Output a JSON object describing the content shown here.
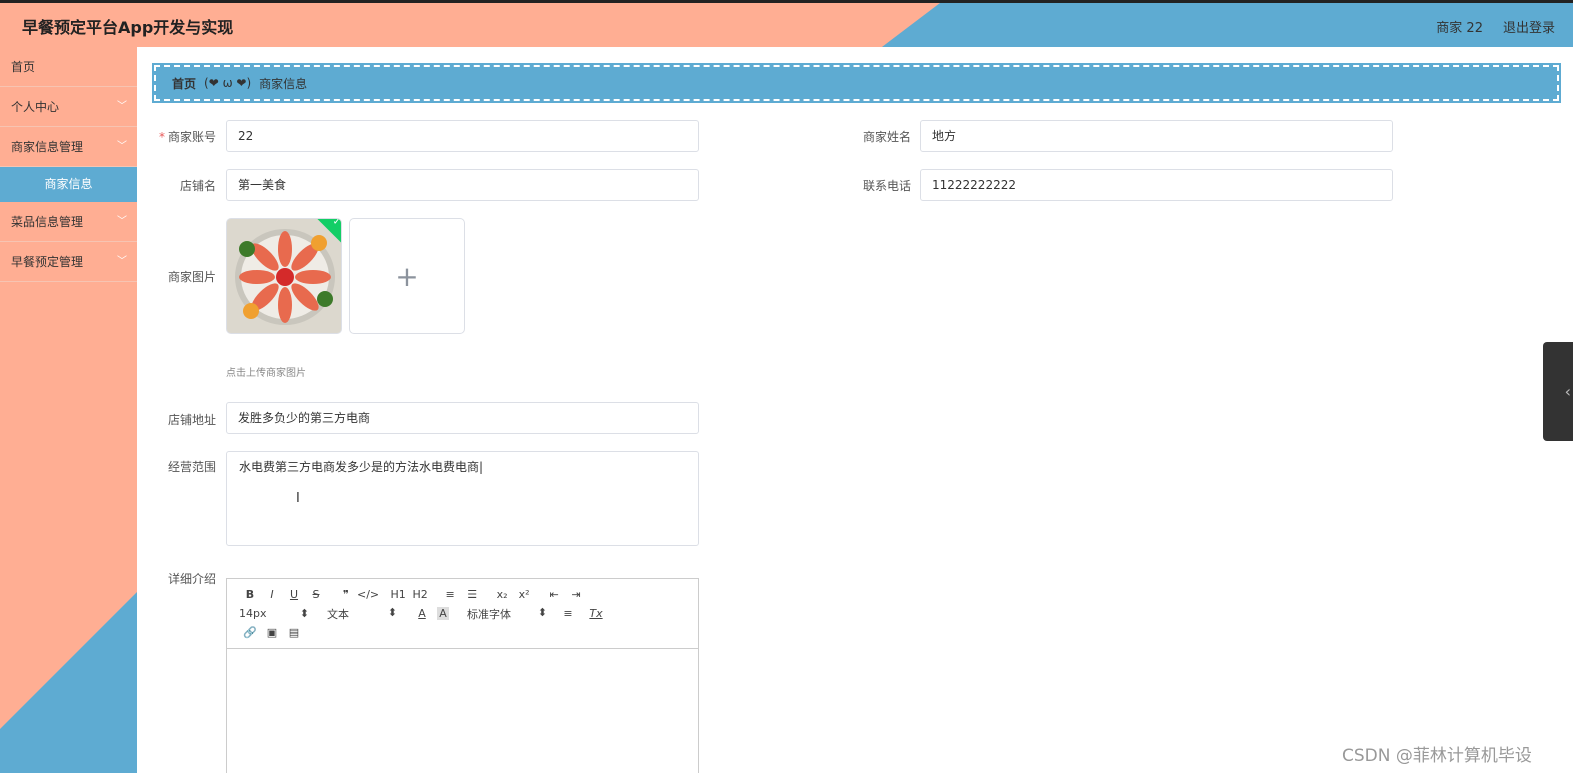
{
  "header": {
    "title": "早餐预定平台App开发与实现",
    "user": "商家 22",
    "logout": "退出登录"
  },
  "sidebar": {
    "items": [
      {
        "label": "首页"
      },
      {
        "label": "个人中心"
      },
      {
        "label": "商家信息管理"
      },
      {
        "label": "商家信息",
        "sub": true
      },
      {
        "label": "菜品信息管理"
      },
      {
        "label": "早餐预定管理"
      }
    ]
  },
  "breadcrumb": {
    "home": "首页",
    "face": "(❤ ω ❤)",
    "current": "商家信息"
  },
  "form": {
    "account_label": "商家账号",
    "account_value": "22",
    "name_label": "商家姓名",
    "name_value": "地方",
    "shop_label": "店铺名",
    "shop_value": "第一美食",
    "phone_label": "联系电话",
    "phone_value": "11222222222",
    "image_label": "商家图片",
    "image_hint": "点击上传商家图片",
    "address_label": "店铺地址",
    "address_value": "发胜多负少的第三方电商",
    "scope_label": "经营范围",
    "scope_value": "水电费第三方电商发多少是的方法水电费电商|",
    "detail_label": "详细介绍"
  },
  "editor": {
    "row1": [
      "B",
      "I",
      "U",
      "S",
      "❞",
      "</>",
      "H1",
      "H2",
      "≡",
      "☰",
      "x₂",
      "x²",
      "⇤",
      "⇥"
    ],
    "font_size": "14px",
    "text_style": "文本",
    "font_family": "标准字体",
    "clear_format": "Tx"
  },
  "watermark": "CSDN @菲林计算机毕设",
  "colors": {
    "salmon": "#ffae93",
    "blue": "#5eabd2"
  }
}
